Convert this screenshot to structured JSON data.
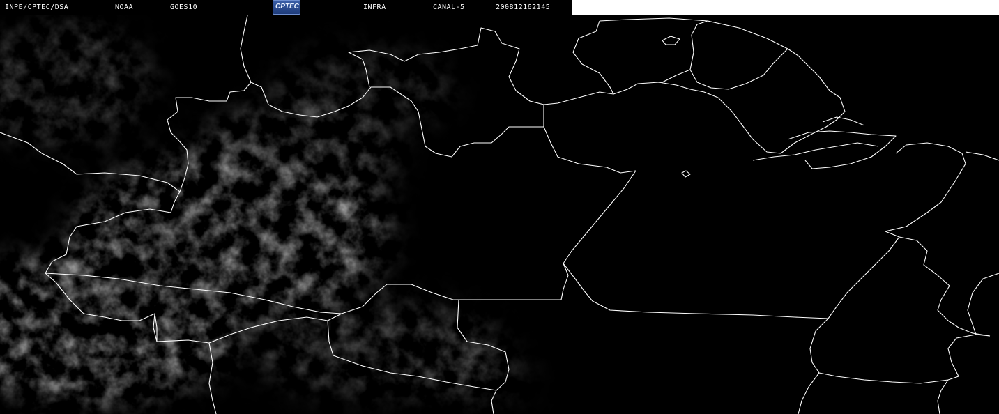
{
  "header": {
    "institution": "INPE/CPTEC/DSA",
    "agency": "NOAA",
    "satellite": "GOES10",
    "logo_text": "CPTEC",
    "product": "INFRA",
    "channel": "CANAL-5",
    "timestamp": "200812162145"
  },
  "map": {
    "background_color": "#000000",
    "border_color": "#ffffff",
    "cloud_color": "#8a8a8a"
  }
}
